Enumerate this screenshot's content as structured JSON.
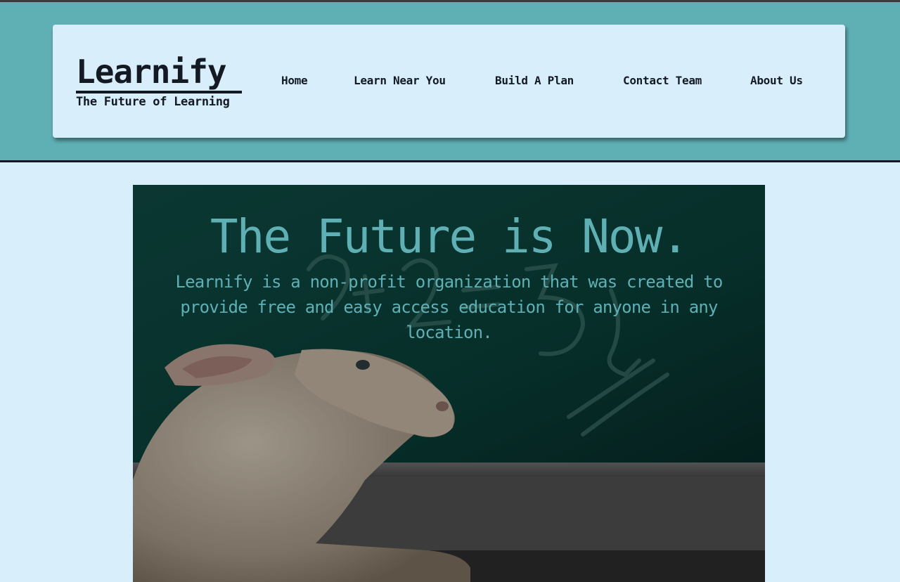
{
  "brand": {
    "title": "Learnify",
    "subtitle": "The Future of Learning"
  },
  "nav": {
    "items": [
      {
        "label": "Home"
      },
      {
        "label": "Learn Near You"
      },
      {
        "label": "Build A Plan"
      },
      {
        "label": "Contact Team"
      },
      {
        "label": "About Us"
      }
    ]
  },
  "hero": {
    "title": "The Future is Now.",
    "description": "Learnify is a non-profit organization that was created to provide free and easy access education for anyone in any location.",
    "image_subject": "lamb in front of chalkboard"
  },
  "colors": {
    "accent": "#5fb0b5",
    "background": "#d8eefb",
    "text": "#131a24"
  }
}
